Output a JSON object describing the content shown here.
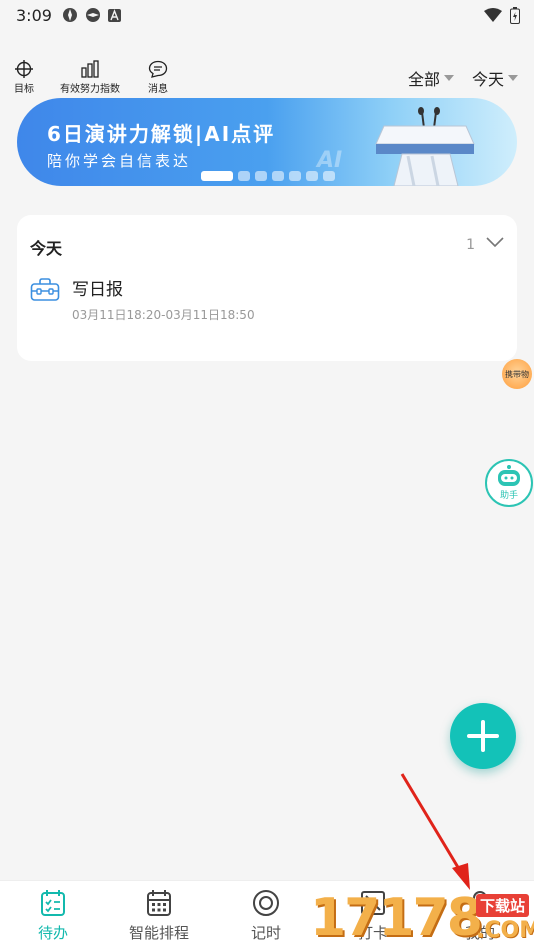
{
  "status_bar": {
    "time": "3:09"
  },
  "toolbar": {
    "goal_label": "目标",
    "effort_label": "有效努力指数",
    "message_label": "消息",
    "filter_all": "全部",
    "filter_today": "今天"
  },
  "banner": {
    "title": "6日演讲力解锁|AI点评",
    "subtitle": "陪你学会自信表达",
    "watermark": "AI",
    "page_count": 7,
    "active_page": 1
  },
  "today_card": {
    "header": "今天",
    "count": "1",
    "items": [
      {
        "title": "写日报",
        "time": "03月11日18:20-03月11日18:50"
      }
    ]
  },
  "floating": {
    "carry_label": "携带物",
    "helper_label": "助手"
  },
  "tabs": [
    {
      "label": "待办",
      "icon": "todo-checklist-icon",
      "active": true
    },
    {
      "label": "智能排程",
      "icon": "calendar-icon",
      "active": false
    },
    {
      "label": "记时",
      "icon": "timer-circle-icon",
      "active": false
    },
    {
      "label": "打卡",
      "icon": "checkin-icon",
      "active": false
    },
    {
      "label": "我的",
      "icon": "user-icon",
      "active": false
    }
  ],
  "watermark_overlay": {
    "number": "17178",
    "site": "下载站",
    "domain": ".COM"
  },
  "colors": {
    "accent": "#13c2b8",
    "banner_start": "#3f87ea",
    "banner_end": "#cfeefc"
  }
}
